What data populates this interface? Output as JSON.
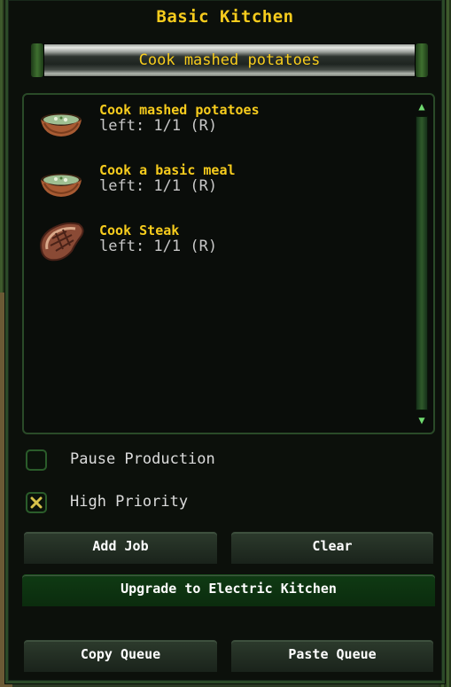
{
  "window": {
    "title": "Basic Kitchen"
  },
  "current_job": {
    "label": "Cook mashed potatoes"
  },
  "queue": {
    "items": [
      {
        "name": "Cook mashed potatoes",
        "left": "left: 1/1 (R)",
        "icon": "soup-bowl-icon"
      },
      {
        "name": "Cook a basic meal",
        "left": "left: 1/1 (R)",
        "icon": "soup-bowl-icon"
      },
      {
        "name": "Cook Steak",
        "left": "left: 1/1 (R)",
        "icon": "steak-icon"
      }
    ]
  },
  "options": {
    "pause_production": {
      "label": "Pause Production",
      "checked": false
    },
    "high_priority": {
      "label": "High Priority",
      "checked": true
    }
  },
  "buttons": {
    "add_job": "Add Job",
    "clear": "Clear",
    "upgrade": "Upgrade to Electric Kitchen",
    "copy_queue": "Copy Queue",
    "paste_queue": "Paste Queue"
  },
  "colors": {
    "accent": "#f7cc1d",
    "frame": "#2c4a28",
    "upgrade_button": "#0f3a13"
  }
}
